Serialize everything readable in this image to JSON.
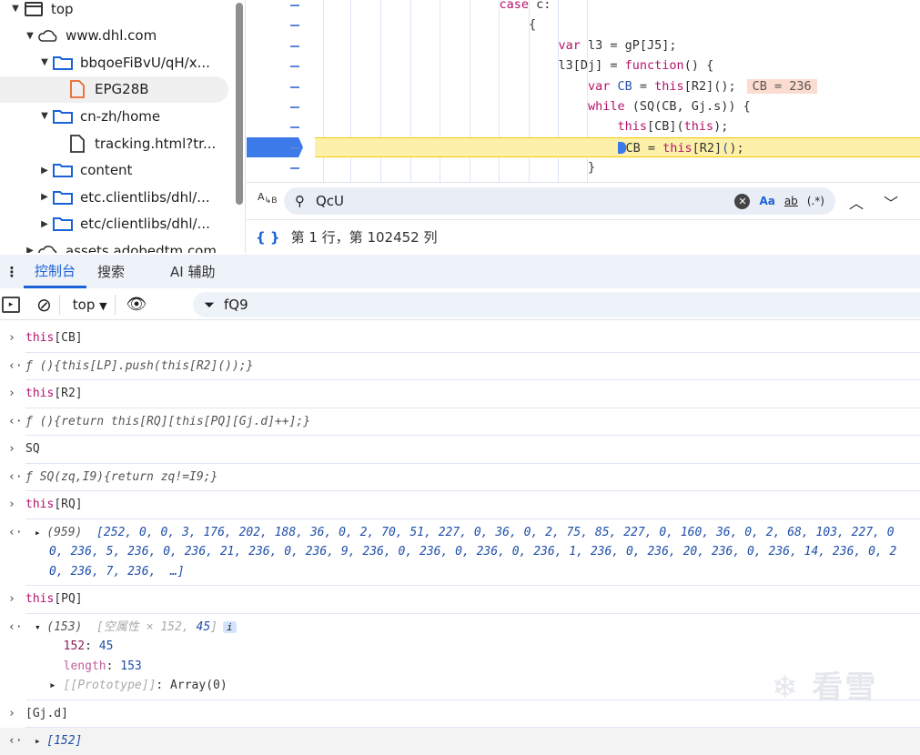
{
  "tree": [
    {
      "label": "top",
      "icon": "frame-icon",
      "level": 0,
      "expanded": true
    },
    {
      "label": "www.dhl.com",
      "icon": "cloud-icon",
      "level": 1,
      "expanded": true
    },
    {
      "label": "bbqoeFiBvU/qH/x...",
      "icon": "folder-icon",
      "level": 2,
      "expanded": true
    },
    {
      "label": "EPG28B",
      "icon": "file-icon-orange",
      "level": 3,
      "selected": true
    },
    {
      "label": "cn-zh/home",
      "icon": "folder-icon",
      "level": 2,
      "expanded": true
    },
    {
      "label": "tracking.html?tr...",
      "icon": "file-icon",
      "level": 3
    },
    {
      "label": "content",
      "icon": "folder-icon",
      "level": 2,
      "expanded": false
    },
    {
      "label": "etc.clientlibs/dhl/...",
      "icon": "folder-icon",
      "level": 2,
      "expanded": false
    },
    {
      "label": "etc/clientlibs/dhl/...",
      "icon": "folder-icon",
      "level": 2,
      "expanded": false
    },
    {
      "label": "assets.adobedtm.com",
      "icon": "cloud-icon",
      "level": 1,
      "expanded": false
    }
  ],
  "code": [
    {
      "indent": 7,
      "tokens": [
        [
          "case",
          "kw"
        ],
        [
          " c:",
          "pl"
        ]
      ]
    },
    {
      "indent": 8,
      "tokens": [
        [
          "{",
          "pl"
        ]
      ]
    },
    {
      "indent": 9,
      "tokens": [
        [
          "var",
          "kw"
        ],
        [
          " l3 = gP[J5];",
          "pl"
        ]
      ]
    },
    {
      "indent": 9,
      "tokens": [
        [
          "l3[Dj] = ",
          "pl"
        ],
        [
          "function",
          "kw"
        ],
        [
          "() {",
          "pl"
        ]
      ]
    },
    {
      "indent": 10,
      "tokens": [
        [
          "var",
          "kw"
        ],
        [
          " CB",
          "id"
        ],
        [
          " = ",
          "pl"
        ],
        [
          "this",
          "kw"
        ],
        [
          "[R2]();",
          "pl"
        ]
      ],
      "inline": "CB = 236"
    },
    {
      "indent": 10,
      "tokens": [
        [
          "while",
          "kw"
        ],
        [
          " (SQ(CB, Gj.s)) {",
          "pl"
        ]
      ]
    },
    {
      "indent": 11,
      "tokens": [
        [
          "this",
          "kw"
        ],
        [
          "[CB](",
          "pl"
        ],
        [
          "this",
          "kw"
        ],
        [
          ");",
          "pl"
        ]
      ]
    },
    {
      "indent": 11,
      "tokens": [
        [
          "CB = ",
          "pl"
        ],
        [
          "this",
          "kw"
        ],
        [
          "[R2]",
          "pl"
        ],
        [
          "(",
          "id"
        ],
        [
          ");",
          "pl"
        ]
      ],
      "paused": true
    },
    {
      "indent": 10,
      "tokens": [
        [
          "}",
          "pl"
        ]
      ]
    }
  ],
  "search": {
    "value": "QcU",
    "match_case": "Aa",
    "whole_word": "ab",
    "regex": "(.*)"
  },
  "status": {
    "position": "第 1 行，第 102452 列"
  },
  "tabs": [
    {
      "label": "控制台",
      "active": true
    },
    {
      "label": "搜索"
    },
    {
      "label": "AI 辅助"
    }
  ],
  "toolbar": {
    "context": "top",
    "filter": "fQ9"
  },
  "console": [
    {
      "type": "in",
      "lines": [
        [
          [
            "this",
            "kw"
          ],
          [
            "[CB]",
            "pl"
          ]
        ]
      ]
    },
    {
      "type": "out",
      "lines": [
        [
          [
            "ƒ ",
            "it"
          ],
          [
            "(){this[LP].push(this[R2]());}",
            "it"
          ]
        ]
      ]
    },
    {
      "type": "in",
      "lines": [
        [
          [
            "this",
            "kw"
          ],
          [
            "[R2]",
            "pl"
          ]
        ]
      ]
    },
    {
      "type": "out",
      "lines": [
        [
          [
            "ƒ ",
            "it"
          ],
          [
            "(){return this[RQ][this[PQ][Gj.d]++];}",
            "it"
          ]
        ]
      ]
    },
    {
      "type": "in",
      "lines": [
        [
          [
            "SQ",
            "pl"
          ]
        ]
      ]
    },
    {
      "type": "out",
      "lines": [
        [
          [
            "ƒ ",
            "it"
          ],
          [
            "SQ(zq,I9){return zq!=I9;}",
            "it"
          ]
        ]
      ]
    },
    {
      "type": "in",
      "lines": [
        [
          [
            "this",
            "kw"
          ],
          [
            "[RQ]",
            "pl"
          ]
        ]
      ]
    },
    {
      "type": "out",
      "expander": "▸",
      "lines": [
        [
          [
            "(959)  ",
            "it"
          ],
          [
            "[252, 0, 0, 3, 176, 202, 188, 36, 0, 2, 70, 51, 227, 0, 36, 0, 2, 75, 85, 227, 0, 160, 36, 0, 2, 68, 103, 227, 0",
            "num"
          ]
        ],
        [
          [
            "0, 236, 5, 236, 0, 236, 21, 236, 0, 236, 9, 236, 0, 236, 0, 236, 0, 236, 1, 236, 0, 236, 20, 236, 0, 236, 14, 236, 0, 2",
            "num"
          ]
        ],
        [
          [
            "0, 236, 7, 236,  …]",
            "num"
          ]
        ]
      ]
    },
    {
      "type": "in",
      "lines": [
        [
          [
            "this",
            "kw"
          ],
          [
            "[PQ]",
            "pl"
          ]
        ]
      ]
    },
    {
      "type": "out",
      "expander": "▾",
      "lines": [
        [
          [
            "(153)  ",
            "it"
          ],
          [
            "[空属性 × 152, ",
            "gr"
          ],
          [
            "45",
            "num"
          ],
          [
            "]",
            "gr"
          ]
        ],
        [
          [
            "  152",
            "key"
          ],
          [
            ": ",
            "pl"
          ],
          [
            "45",
            "nb"
          ]
        ],
        [
          [
            "  length",
            "key2"
          ],
          [
            ": ",
            "pl"
          ],
          [
            "153",
            "nb"
          ]
        ],
        [
          [
            "▸ ",
            "pl"
          ],
          [
            "[[Prototype]]",
            "gr"
          ],
          [
            ": Array(0)",
            "pl"
          ]
        ]
      ],
      "info": "i"
    },
    {
      "type": "in",
      "lines": [
        [
          [
            "[Gj.d]",
            "pl"
          ]
        ]
      ]
    },
    {
      "type": "out",
      "expander": "▸",
      "lines": [
        [
          [
            "[152]",
            "num"
          ]
        ]
      ]
    }
  ],
  "watermark": "看雪"
}
